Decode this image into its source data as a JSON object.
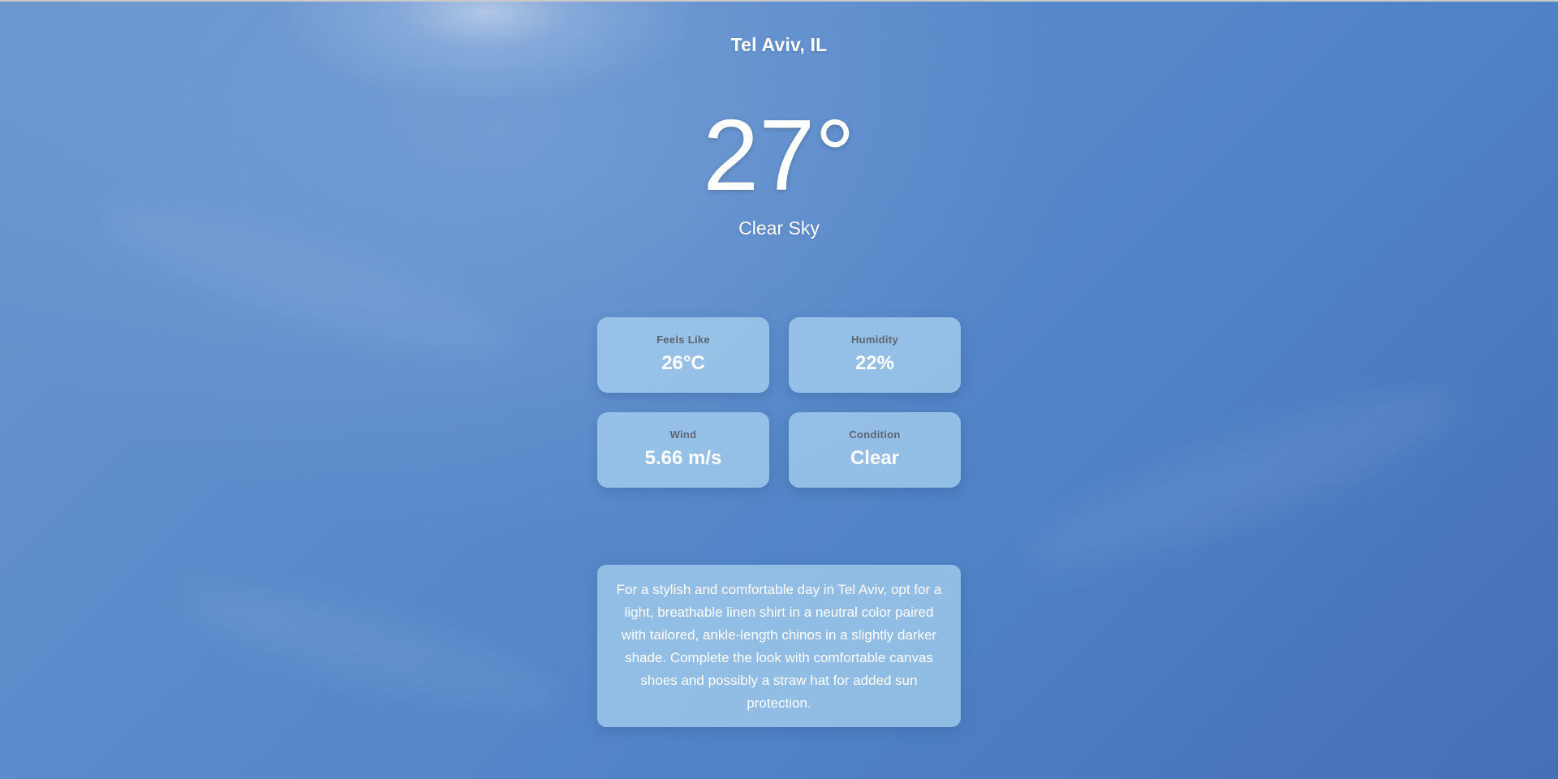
{
  "location": {
    "city": "Tel Aviv, IL"
  },
  "current": {
    "temperature": "27°",
    "description": "Clear Sky"
  },
  "stats": [
    {
      "label": "Feels Like",
      "value": "26°C"
    },
    {
      "label": "Humidity",
      "value": "22%"
    },
    {
      "label": "Wind",
      "value": "5.66 m/s"
    },
    {
      "label": "Condition",
      "value": "Clear"
    }
  ],
  "outfit_advice": "For a stylish and comfortable day in Tel Aviv, opt for a light, breathable linen shirt in a neutral color paired with tailored, ankle-length chinos in a slightly darker shade. Complete the look with comfortable canvas shoes and possibly a straw hat for added sun protection.",
  "theme": {
    "sky_top": "#6b97cf",
    "sky_bottom": "#466fb6",
    "card_background": "#aad2f0",
    "label_color": "#5d6570",
    "text_color": "#ffffff"
  }
}
